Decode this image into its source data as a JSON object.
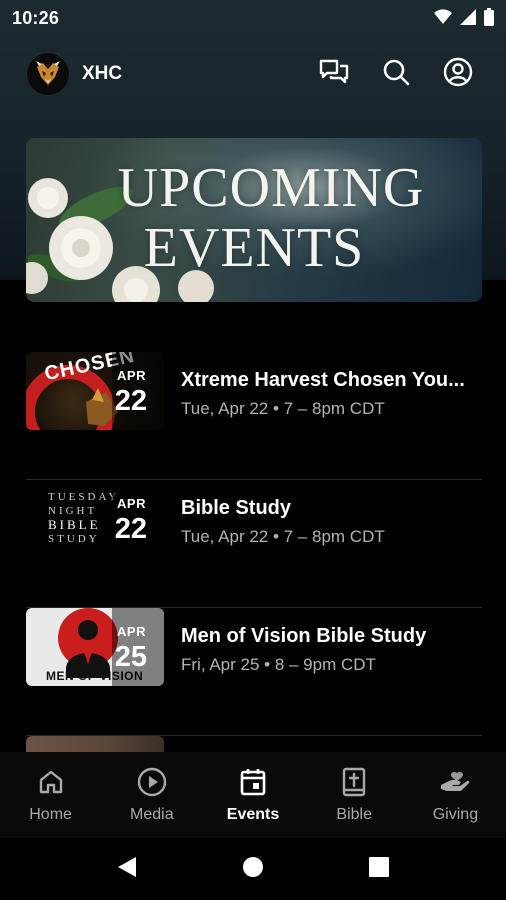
{
  "status_bar": {
    "time": "10:26"
  },
  "header": {
    "title": "XHC"
  },
  "banner": {
    "line1": "UPCOMING",
    "line2": "EVENTS"
  },
  "events": [
    {
      "month": "APR",
      "day": "22",
      "title": "Xtreme Harvest Chosen You...",
      "time": "Tue, Apr 22 • 7 – 8pm CDT",
      "thumb_text": "CHOSEN"
    },
    {
      "month": "APR",
      "day": "22",
      "title": "Bible Study",
      "time": "Tue, Apr 22 • 7 – 8pm CDT",
      "thumb_text": [
        "TUESDAY",
        "NIGHT",
        "BIBLE",
        "STUDY"
      ]
    },
    {
      "month": "APR",
      "day": "25",
      "title": "Men of Vision Bible Study",
      "time": "Fri, Apr 25 • 8 – 9pm CDT",
      "thumb_text": "MEN OF VISION"
    }
  ],
  "bottom_nav": [
    {
      "label": "Home",
      "icon": "home-icon",
      "active": false
    },
    {
      "label": "Media",
      "icon": "play-circle-icon",
      "active": false
    },
    {
      "label": "Events",
      "icon": "calendar-icon",
      "active": true
    },
    {
      "label": "Bible",
      "icon": "bible-icon",
      "active": false
    },
    {
      "label": "Giving",
      "icon": "giving-hand-icon",
      "active": false
    }
  ],
  "colors": {
    "background": "#000000",
    "header_gradient": "#1d2a2f",
    "secondary_text": "#b3b3b3",
    "divider": "#2b2b2b",
    "nav_inactive": "#a9a9a9"
  }
}
